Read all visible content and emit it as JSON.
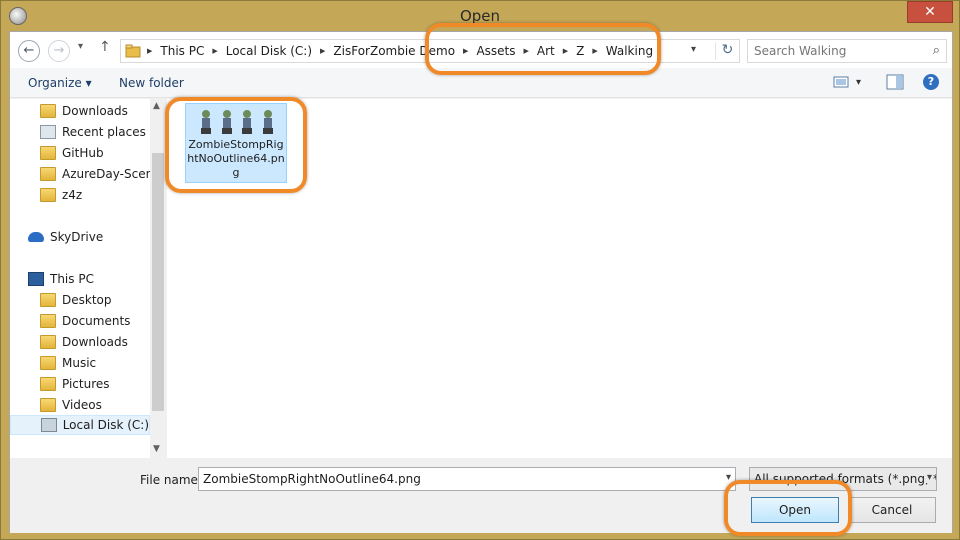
{
  "window": {
    "title": "Open",
    "close_label": "✕"
  },
  "nav": {
    "back": "←",
    "forward": "→",
    "recent": "▾",
    "up": "↑",
    "breadcrumbs": [
      "This PC",
      "Local Disk (C:)",
      "ZisForZombie Demo",
      "Assets",
      "Art",
      "Z",
      "Walking"
    ],
    "refresh": "↻",
    "search_placeholder": "Search Walking"
  },
  "toolbar": {
    "organize": "Organize ▾",
    "new_folder": "New folder",
    "view": "▾",
    "help": "?"
  },
  "sidebar": {
    "items": [
      {
        "label": "Downloads",
        "icon": "download-folder-icon"
      },
      {
        "label": "Recent places",
        "icon": "recent-places-icon"
      },
      {
        "label": "GitHub",
        "icon": "folder-icon"
      },
      {
        "label": "AzureDay-Scenar",
        "icon": "folder-icon"
      },
      {
        "label": "z4z",
        "icon": "folder-icon"
      },
      {
        "label": "SkyDrive",
        "icon": "skydrive-icon"
      },
      {
        "label": "This PC",
        "icon": "computer-icon"
      },
      {
        "label": "Desktop",
        "icon": "desktop-folder-icon"
      },
      {
        "label": "Documents",
        "icon": "documents-folder-icon"
      },
      {
        "label": "Downloads",
        "icon": "download-folder-icon"
      },
      {
        "label": "Music",
        "icon": "music-folder-icon"
      },
      {
        "label": "Pictures",
        "icon": "pictures-folder-icon"
      },
      {
        "label": "Videos",
        "icon": "videos-folder-icon"
      },
      {
        "label": "Local Disk (C:)",
        "icon": "drive-icon"
      }
    ]
  },
  "files": [
    {
      "name": "ZombieStompRightNoOutline64.png",
      "selected": true
    }
  ],
  "bottom": {
    "file_name_label": "File name:",
    "file_name_value": "ZombieStompRightNoOutline64.png",
    "filter": "All supported formats (*.png; *.",
    "open_label": "Open",
    "cancel_label": "Cancel"
  },
  "colors": {
    "highlight": "#f08a28",
    "selection": "#cce8ff",
    "window_frame": "#c4a858",
    "close": "#c7503f"
  }
}
